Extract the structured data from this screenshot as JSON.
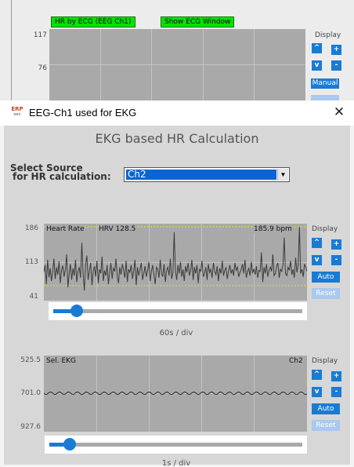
{
  "background_window": {
    "hr_by_ecg_button": "HR by ECG (EEG Ch1)",
    "show_ecg_button": "Show ECG Window",
    "y_ticks": [
      "117",
      "76"
    ],
    "display_label": "Display",
    "up_label": "^",
    "plus_label": "+",
    "down_label": "v",
    "minus_label": "-",
    "manual_label": "Manual"
  },
  "dialog": {
    "title": "EEG-Ch1 used for EKG",
    "logo_text": "ERP",
    "logo_sub": "sec",
    "close_label": "✕",
    "heading": "EKG based HR Calculation",
    "select_label_line1": "Select Source",
    "select_label_line2": "for HR calculation:",
    "select_value": "Ch2",
    "select_arrow": "▼"
  },
  "hr_plot": {
    "label": "Heart Rate",
    "hrv_label": "HRV 128.5",
    "bpm_label": "185.9 bpm",
    "y_ticks": [
      "186",
      "113",
      "41"
    ],
    "display_label": "Display",
    "up_label": "^",
    "plus_label": "+",
    "down_label": "v",
    "minus_label": "-",
    "auto_label": "Auto",
    "reset_label": "Reset",
    "time_div": "60s / div",
    "slider_position": 0.12,
    "trace": [
      95,
      108,
      72,
      118,
      85,
      102,
      78,
      96,
      120,
      82,
      104,
      90,
      115,
      74,
      98,
      107,
      86,
      100,
      128,
      66,
      92,
      110,
      80,
      102,
      88,
      118,
      76,
      96,
      104,
      84,
      150,
      92,
      60,
      108,
      126,
      80,
      98,
      112,
      70,
      96,
      106,
      86,
      116,
      74,
      100,
      92,
      124,
      78,
      98,
      88,
      108,
      72,
      94,
      112,
      82,
      102,
      96,
      120,
      86,
      74,
      104,
      90,
      110,
      98,
      84,
      116,
      76,
      100,
      94,
      108,
      82,
      96,
      118,
      70,
      104,
      88,
      100,
      112,
      80,
      92,
      106,
      86,
      98,
      114,
      78,
      96,
      108,
      90,
      72,
      104,
      100,
      84,
      118,
      92,
      86,
      110,
      76,
      98,
      104,
      88,
      120,
      82,
      94,
      170,
      96,
      80,
      108,
      92,
      114,
      86,
      100,
      78,
      106,
      94,
      112,
      88,
      98,
      118,
      80,
      104,
      92,
      108,
      74,
      100,
      96,
      116,
      86,
      92,
      104,
      80,
      110,
      94,
      100,
      84,
      112,
      96,
      90,
      106,
      78,
      102,
      92,
      116,
      88,
      98,
      104,
      82,
      96,
      108,
      92,
      100,
      88,
      112,
      98,
      104,
      86,
      94,
      100,
      110,
      92,
      118,
      84,
      96,
      102,
      88,
      114,
      94,
      100,
      90,
      106,
      84,
      98,
      96,
      132,
      76,
      104,
      92,
      110,
      86,
      98,
      104,
      96,
      128,
      88,
      92,
      106,
      112,
      84,
      100,
      96,
      108,
      160,
      92,
      88,
      104,
      98,
      116,
      90,
      100,
      84,
      122,
      94,
      108,
      180,
      92,
      100,
      86,
      110,
      104,
      96
    ]
  },
  "ekg_plot": {
    "label": "Sel. EKG",
    "channel": "Ch2",
    "y_ticks": [
      "525.5",
      "701.0",
      "927.6"
    ],
    "display_label": "Display",
    "up_label": "^",
    "plus_label": "+",
    "down_label": "v",
    "minus_label": "-",
    "auto_label": "Auto",
    "reset_label": "Reset",
    "time_div": "1s / div",
    "slider_position": 0.09
  }
}
